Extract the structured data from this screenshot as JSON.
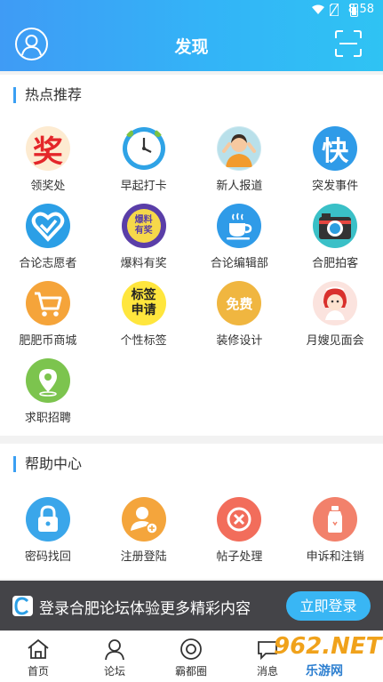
{
  "status_bar": {
    "time": "8:58"
  },
  "header": {
    "title": "发现"
  },
  "hot_section": {
    "title": "热点推荐",
    "items": [
      {
        "label": "领奖处",
        "icon": "award-icon"
      },
      {
        "label": "早起打卡",
        "icon": "clock-icon"
      },
      {
        "label": "新人报道",
        "icon": "newcomer-icon"
      },
      {
        "label": "突发事件",
        "icon": "breaking-news-icon"
      },
      {
        "label": "合论志愿者",
        "icon": "volunteer-heart-icon"
      },
      {
        "label": "爆料有奖",
        "icon": "tip-reward-icon"
      },
      {
        "label": "合论编辑部",
        "icon": "coffee-cup-icon"
      },
      {
        "label": "合肥拍客",
        "icon": "camera-icon"
      },
      {
        "label": "肥肥币商城",
        "icon": "shopping-cart-icon"
      },
      {
        "label": "个性标签",
        "icon": "tag-icon"
      },
      {
        "label": "装修设计",
        "icon": "free-badge-icon"
      },
      {
        "label": "月嫂见面会",
        "icon": "nanny-icon"
      },
      {
        "label": "求职招聘",
        "icon": "location-pin-icon"
      }
    ],
    "icon_text": {
      "award": "奖",
      "breaking": "快",
      "tip": "爆料\n有奖",
      "tag": "标签\n申请",
      "free": "免费"
    }
  },
  "help_section": {
    "title": "帮助中心",
    "items": [
      {
        "label": "密码找回",
        "icon": "lock-icon"
      },
      {
        "label": "注册登陆",
        "icon": "user-add-icon"
      },
      {
        "label": "帖子处理",
        "icon": "delete-post-icon"
      },
      {
        "label": "申诉和注销",
        "icon": "bottle-icon"
      }
    ]
  },
  "login_banner": {
    "text": "登录合肥论坛体验更多精彩内容",
    "button": "立即登录"
  },
  "tabbar": {
    "tabs": [
      {
        "label": "首页",
        "icon": "home-icon"
      },
      {
        "label": "论坛",
        "icon": "forum-icon"
      },
      {
        "label": "霸都圈",
        "icon": "circle-icon"
      },
      {
        "label": "消息",
        "icon": "message-icon"
      }
    ]
  },
  "watermark": {
    "brand": "962.NET",
    "sub": "乐游网"
  },
  "colors": {
    "accent": "#39b6f4",
    "header_start": "#3f9bf5",
    "header_end": "#2fc3f3"
  }
}
